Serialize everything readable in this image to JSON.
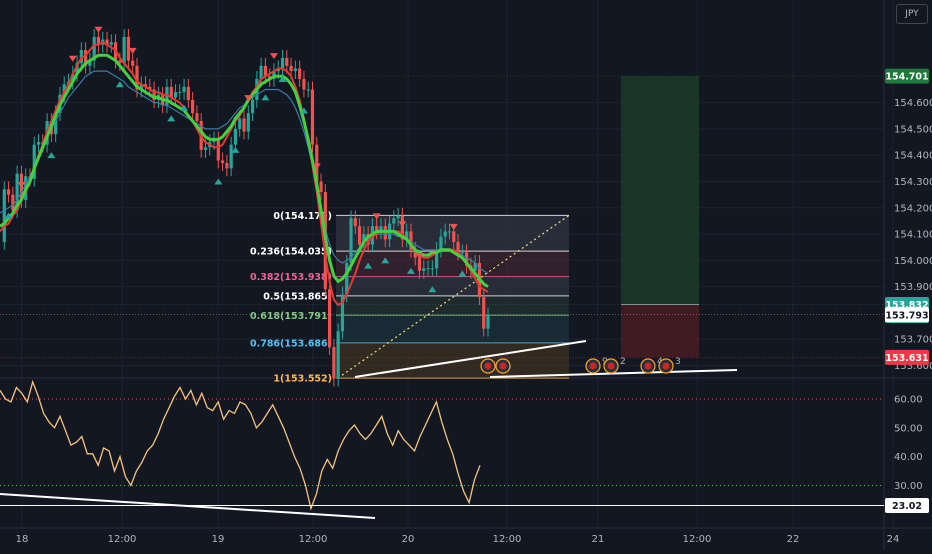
{
  "symbol": {
    "currency": "JPY"
  },
  "chart_data": [
    {
      "type": "line",
      "ylim": [
        153.56,
        154.96
      ],
      "y_ticks": [
        154.6,
        154.5,
        154.4,
        154.3,
        154.2,
        154.1,
        154.0,
        153.9,
        153.7,
        153.6
      ],
      "x_ticks": [
        "18",
        "12:00",
        "19",
        "12:00",
        "20",
        "12:00",
        "21",
        "12:00",
        "22",
        "24"
      ],
      "price_badges": [
        {
          "text": "154.701",
          "value": 154.701,
          "color": "#1e7a3c"
        },
        {
          "text": "153.832",
          "sub": "04:07",
          "value": 153.832,
          "color": "#26a69a"
        },
        {
          "text": "153.793",
          "value": 153.793,
          "color": "#ffffff"
        },
        {
          "text": "153.631",
          "value": 153.631,
          "color": "#f23645"
        }
      ],
      "fibonacci": [
        {
          "label": "0(154.171)",
          "value": 154.171,
          "color": "#ffffff"
        },
        {
          "label": "0.236(154.035)",
          "value": 154.035,
          "color": "#ffffff"
        },
        {
          "label": "0.382(153.938)",
          "value": 153.938,
          "color": "#f06292"
        },
        {
          "label": "0.5(153.865)",
          "value": 153.865,
          "color": "#ffffff"
        },
        {
          "label": "0.618(153.791)",
          "value": 153.791,
          "color": "#81c784"
        },
        {
          "label": "0.786(153.686)",
          "value": 153.686,
          "color": "#4fc3f7"
        },
        {
          "label": "1(153.552)",
          "value": 153.552,
          "color": "#ffb74d"
        }
      ],
      "position_tool": {
        "target": 154.701,
        "entry": 153.832,
        "stop": 153.631
      },
      "event_markers": [
        {
          "count": ""
        },
        {
          "count": ""
        },
        {
          "count": "9"
        },
        {
          "count": "2"
        },
        {
          "count": "4"
        },
        {
          "count": "3"
        }
      ],
      "series": [
        {
          "values": [
            154.07,
            154.27,
            154.25,
            154.19,
            154.33,
            154.23,
            154.32,
            154.31,
            154.44,
            154.45,
            154.44,
            154.53,
            154.48,
            154.56,
            154.63,
            154.67,
            154.68,
            154.71,
            154.75,
            154.8,
            154.74,
            154.76,
            154.85,
            154.82,
            154.84,
            154.82,
            154.83,
            154.76,
            154.75,
            154.85,
            154.76,
            154.74,
            154.65,
            154.67,
            154.66,
            154.65,
            154.61,
            154.63,
            154.59,
            154.66,
            154.62,
            154.64,
            154.64,
            154.66,
            154.61,
            154.56,
            154.53,
            154.42,
            154.43,
            154.45,
            154.46,
            154.38,
            154.37,
            154.35,
            154.44,
            154.5,
            154.54,
            154.49,
            154.56,
            154.61,
            154.69,
            154.74,
            154.7,
            154.69,
            154.72,
            154.73,
            154.77,
            154.74,
            154.72,
            154.73,
            154.69,
            154.65,
            154.65,
            154.44,
            154.3,
            154.26,
            153.89,
            153.67,
            153.55,
            153.73,
            153.87,
            153.99,
            154.16,
            154.13,
            154.06,
            154.1,
            154.06,
            154.13,
            154.11,
            154.13,
            154.08,
            154.14,
            154.16,
            154.17,
            154.08,
            154.11,
            154.04,
            154.01,
            153.96,
            153.97,
            153.97,
            153.97,
            154.04,
            154.09,
            154.11,
            154.11,
            154.07,
            154.03,
            154.03,
            153.98,
            153.96,
            153.99,
            153.86,
            153.74,
            153.79
          ]
        },
        {
          "values": [
            154.11,
            154.13,
            154.14,
            154.17,
            154.19,
            154.23,
            154.26,
            154.3,
            154.35,
            154.4,
            154.44,
            154.49,
            154.53,
            154.57,
            154.61,
            154.64,
            154.67,
            154.71,
            154.74,
            154.77,
            154.78,
            154.8,
            154.82,
            154.82,
            154.83,
            154.82,
            154.81,
            154.8,
            154.77,
            154.75,
            154.73,
            154.71,
            154.68,
            154.67,
            154.66,
            154.65,
            154.64,
            154.64,
            154.63,
            154.63,
            154.62,
            154.61,
            154.6,
            154.58,
            154.55,
            154.53,
            154.5,
            154.47,
            154.45,
            154.44,
            154.43,
            154.43,
            154.44,
            154.47,
            154.5,
            154.53,
            154.55,
            154.58,
            154.61,
            154.64,
            154.66,
            154.69,
            154.7,
            154.71,
            154.72,
            154.73,
            154.73,
            154.72,
            154.7,
            154.66,
            154.61,
            154.54,
            154.46,
            154.36,
            154.26,
            154.14,
            154.02,
            153.92,
            153.85,
            153.83,
            153.84,
            153.87,
            153.91,
            153.95,
            154.0,
            154.04,
            154.07,
            154.09,
            154.1,
            154.11,
            154.11,
            154.11,
            154.11,
            154.11,
            154.1,
            154.08,
            154.06,
            154.04,
            154.02,
            154.01,
            154.01,
            154.02,
            154.03,
            154.04,
            154.04,
            154.04,
            154.04,
            154.03,
            154.01,
            153.99,
            153.96,
            153.93,
            153.9,
            153.89,
            153.88
          ]
        },
        {
          "values": [
            154.13,
            154.14,
            154.16,
            154.18,
            154.21,
            154.23,
            154.27,
            154.3,
            154.35,
            154.39,
            154.43,
            154.47,
            154.51,
            154.55,
            154.59,
            154.62,
            154.65,
            154.68,
            154.71,
            154.73,
            154.75,
            154.76,
            154.77,
            154.78,
            154.78,
            154.78,
            154.77,
            154.76,
            154.74,
            154.72,
            154.7,
            154.68,
            154.66,
            154.65,
            154.64,
            154.63,
            154.62,
            154.62,
            154.61,
            154.61,
            154.6,
            154.59,
            154.58,
            154.57,
            154.55,
            154.53,
            154.51,
            154.49,
            154.47,
            154.46,
            154.46,
            154.46,
            154.47,
            154.49,
            154.51,
            154.54,
            154.56,
            154.58,
            154.61,
            154.63,
            154.65,
            154.67,
            154.68,
            154.69,
            154.7,
            154.7,
            154.7,
            154.69,
            154.67,
            154.64,
            154.59,
            154.53,
            154.46,
            154.38,
            154.29,
            154.19,
            154.09,
            154.0,
            153.94,
            153.92,
            153.93,
            153.95,
            153.98,
            154.01,
            154.04,
            154.07,
            154.09,
            154.1,
            154.11,
            154.11,
            154.11,
            154.11,
            154.11,
            154.1,
            154.09,
            154.08,
            154.06,
            154.04,
            154.03,
            154.02,
            154.02,
            154.03,
            154.03,
            154.04,
            154.04,
            154.04,
            154.03,
            154.02,
            154.01,
            153.99,
            153.97,
            153.95,
            153.93,
            153.91,
            153.9
          ]
        },
        {
          "values": [
            154.18,
            154.19,
            154.2,
            154.21,
            154.23,
            154.26,
            154.29,
            154.32,
            154.35,
            154.39,
            154.43,
            154.46,
            154.5,
            154.53,
            154.56,
            154.59,
            154.62,
            154.64,
            154.66,
            154.68,
            154.7,
            154.71,
            154.72,
            154.72,
            154.72,
            154.72,
            154.71,
            154.7,
            154.69,
            154.68,
            154.66,
            154.65,
            154.64,
            154.63,
            154.62,
            154.61,
            154.6,
            154.6,
            154.59,
            154.59,
            154.58,
            154.57,
            154.56,
            154.55,
            154.54,
            154.53,
            154.52,
            154.51,
            154.5,
            154.5,
            154.5,
            154.5,
            154.51,
            154.52,
            154.54,
            154.56,
            154.58,
            154.59,
            154.61,
            154.62,
            154.63,
            154.64,
            154.65,
            154.65,
            154.65,
            154.65,
            154.64,
            154.63,
            154.61,
            154.58,
            154.54,
            154.49,
            154.43,
            154.36,
            154.28,
            154.2,
            154.12,
            154.06,
            154.02,
            154.0,
            153.99,
            154.0,
            154.01,
            154.03,
            154.05,
            154.07,
            154.08,
            154.09,
            154.1,
            154.1,
            154.1,
            154.1,
            154.1,
            154.09,
            154.09,
            154.08,
            154.07,
            154.06,
            154.05,
            154.04,
            154.04,
            154.04,
            154.04,
            154.04,
            154.04,
            154.04,
            154.04,
            154.03,
            154.02,
            154.01,
            154.0,
            153.99,
            153.97,
            153.96,
            153.95
          ]
        }
      ]
    },
    {
      "type": "line",
      "ylim": [
        18,
        68
      ],
      "y_ticks": [
        60,
        50,
        40,
        30
      ],
      "levels": [
        60,
        30
      ],
      "last_value": {
        "text": "23.02",
        "value": 23.02
      },
      "series": [
        {
          "values": [
            63,
            60,
            59,
            64,
            62,
            59,
            66,
            61,
            55,
            52,
            50,
            54,
            49,
            44,
            45,
            47,
            41,
            41,
            37,
            43,
            42,
            35,
            40,
            33,
            30,
            35,
            38,
            42,
            44,
            48,
            53,
            57,
            61,
            64,
            60,
            63,
            58,
            62,
            57,
            56,
            59,
            53,
            56,
            55,
            59,
            58,
            55,
            50,
            52,
            55,
            58,
            54,
            50,
            45,
            40,
            36,
            30,
            22,
            27,
            35,
            39,
            36,
            42,
            46,
            49,
            51,
            48,
            46,
            48,
            51,
            54,
            48,
            44,
            49,
            46,
            44,
            42,
            47,
            51,
            55,
            59,
            52,
            46,
            41,
            34,
            28,
            24,
            32,
            37
          ]
        }
      ]
    }
  ]
}
